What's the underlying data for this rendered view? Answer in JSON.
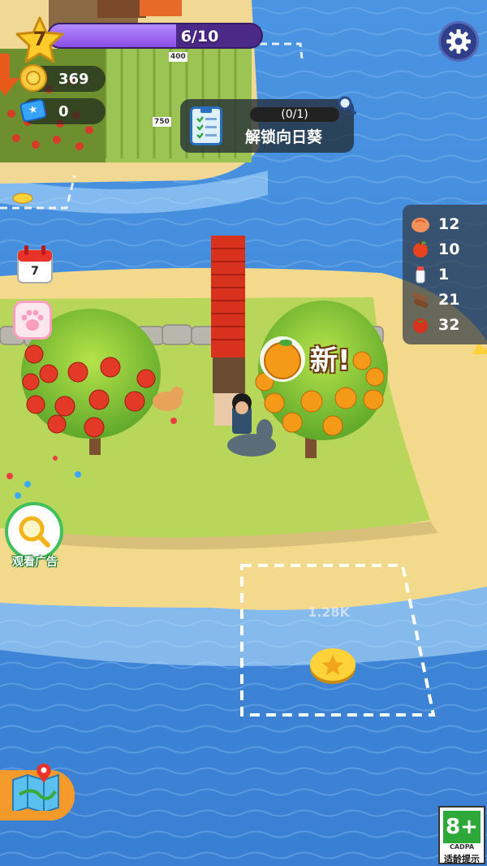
{
  "hud": {
    "level": "7",
    "xp_text": "6/10",
    "xp_fraction": 0.6,
    "coins": "369",
    "tickets": "0"
  },
  "task": {
    "progress": "(0/1)",
    "title": "解锁向日葵"
  },
  "resources": [
    {
      "icon": "peach-icon",
      "count": "12"
    },
    {
      "icon": "apple-icon",
      "count": "10"
    },
    {
      "icon": "milk-bottle-icon",
      "count": "1"
    },
    {
      "icon": "wood-log-icon",
      "count": "21"
    },
    {
      "icon": "tomato-icon",
      "count": "32"
    }
  ],
  "calendar": {
    "day": "7"
  },
  "new_item": {
    "label": "新!"
  },
  "watch_ad": {
    "label": "观看广告"
  },
  "unlock_plot": {
    "price": "1.28K"
  },
  "field_prices": [
    "400",
    "750"
  ],
  "age_rating": {
    "rating": "8+",
    "org": "CADPA",
    "tip": "适龄提示"
  },
  "colors": {
    "sea": "#3f88d8",
    "sand": "#f3d98c",
    "grass": "#b8d85a",
    "xp_fill": "#9a5cf0",
    "accent_green": "#2fa83a"
  }
}
